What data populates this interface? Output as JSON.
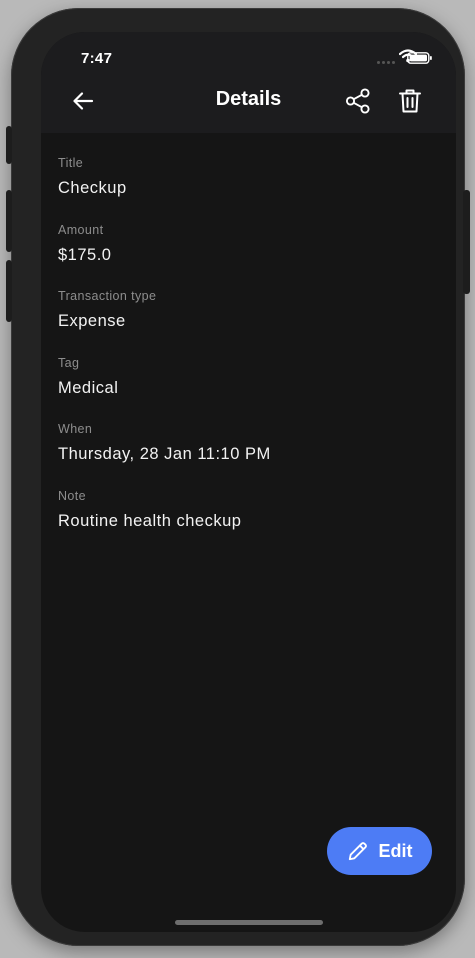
{
  "status_bar": {
    "time": "7:47",
    "icons": [
      "cellular-signal-icon",
      "wifi-icon",
      "battery-icon"
    ]
  },
  "app_bar": {
    "title": "Details",
    "back_icon": "arrow-left-icon",
    "actions": [
      "share-icon",
      "trash-icon"
    ]
  },
  "details": [
    {
      "label": "Title",
      "value": "Checkup"
    },
    {
      "label": "Amount",
      "value": "$175.0"
    },
    {
      "label": "Transaction type",
      "value": "Expense"
    },
    {
      "label": "Tag",
      "value": "Medical"
    },
    {
      "label": "When",
      "value": "Thursday, 28 Jan 11:10 PM"
    },
    {
      "label": "Note",
      "value": "Routine health checkup"
    }
  ],
  "fab": {
    "label": "Edit",
    "icon": "pencil-icon"
  },
  "colors": {
    "background": "#151515",
    "app_bar": "#1c1c1e",
    "accent": "#4d7cf5",
    "label": "#8d8d8d",
    "text": "#f2f2f2"
  }
}
